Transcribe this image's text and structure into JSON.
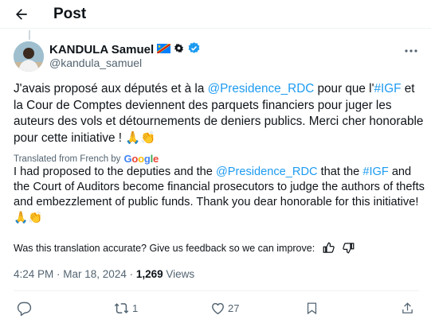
{
  "header": {
    "title": "Post"
  },
  "author": {
    "name": "KANDULA Samuel",
    "handle": "@kandula_samuel"
  },
  "post": {
    "seg1": "J'avais proposé aux députés et à la ",
    "mention1": "@Presidence_RDC",
    "seg2": " pour que l'",
    "hashtag1": "#IGF",
    "seg3": " et la Cour de Comptes deviennent des parquets financiers pour juger les auteurs des vols et détournements de deniers publics. Merci cher honorable pour cette initiative ! 🙏👏"
  },
  "translation": {
    "label": "Translated from French by",
    "provider": "Google",
    "seg1": "I had proposed to the deputies and the ",
    "mention1": "@Presidence_RDC",
    "seg2": " that the ",
    "hashtag1": "#IGF",
    "seg3": " and the Court of Auditors become financial prosecutors to judge the authors of thefts and embezzlement of public funds. Thank you dear honorable for this initiative! 🙏👏"
  },
  "feedback": {
    "question": "Was this translation accurate? Give us feedback so we can improve:"
  },
  "meta": {
    "time": "4:24 PM",
    "sep": " · ",
    "date": "Mar 18, 2024",
    "views_count": "1,269",
    "views_label": " Views"
  },
  "actions": {
    "reposts": "1",
    "likes": "27"
  },
  "colors": {
    "accent": "#1d9bf0",
    "secondary_text": "#536471",
    "primary_text": "#0f1419"
  }
}
